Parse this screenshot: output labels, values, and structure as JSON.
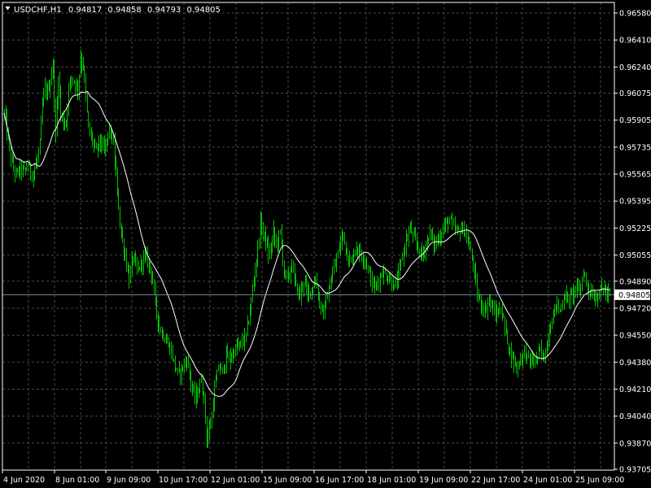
{
  "header": {
    "symbol": "USDCHF,H1",
    "open": "0.94817",
    "high": "0.94858",
    "low": "0.94793",
    "close": "0.94805"
  },
  "colors": {
    "background": "#000000",
    "grid": "#4a4a4a",
    "frame": "#ffffff",
    "bars": "#00c000",
    "moving_average": "#ffffff",
    "bid_line": "#778899"
  },
  "icons": {
    "menu": "triangle-down-icon"
  },
  "chart_data": {
    "type": "bar",
    "title": "USDCHF,H1",
    "grid": true,
    "ylim": [
      0.93705,
      0.9658
    ],
    "y_ticks": [
      "0.96580",
      "0.96410",
      "0.96240",
      "0.96075",
      "0.95905",
      "0.95735",
      "0.95565",
      "0.95395",
      "0.95225",
      "0.95055",
      "0.94890",
      "0.94720",
      "0.94550",
      "0.94380",
      "0.94210",
      "0.94040",
      "0.93870",
      "0.93705"
    ],
    "x_ticks": [
      "4 Jun 2020",
      "8 Jun 01:00",
      "9 Jun 09:00",
      "10 Jun 17:00",
      "12 Jun 01:00",
      "15 Jun 09:00",
      "16 Jun 17:00",
      "18 Jun 01:00",
      "19 Jun 09:00",
      "22 Jun 17:00",
      "24 Jun 01:00",
      "25 Jun 09:00"
    ],
    "bid_price": "0.94805",
    "close_anchors": [
      [
        0,
        0.9595
      ],
      [
        3,
        0.9578
      ],
      [
        6,
        0.9562
      ],
      [
        9,
        0.9556
      ],
      [
        12,
        0.956
      ],
      [
        15,
        0.9558
      ],
      [
        18,
        0.9562
      ],
      [
        21,
        0.9556
      ],
      [
        24,
        0.9562
      ],
      [
        27,
        0.9575
      ],
      [
        29,
        0.96
      ],
      [
        31,
        0.961
      ],
      [
        33,
        0.9608
      ],
      [
        35,
        0.9615
      ],
      [
        37,
        0.9625
      ],
      [
        39,
        0.958
      ],
      [
        41,
        0.962
      ],
      [
        43,
        0.9595
      ],
      [
        45,
        0.9588
      ],
      [
        47,
        0.959
      ],
      [
        49,
        0.961
      ],
      [
        51,
        0.9618
      ],
      [
        53,
        0.9615
      ],
      [
        56,
        0.961
      ],
      [
        58,
        0.963
      ],
      [
        60,
        0.9625
      ],
      [
        62,
        0.9605
      ],
      [
        64,
        0.9585
      ],
      [
        66,
        0.958
      ],
      [
        68,
        0.9575
      ],
      [
        70,
        0.957
      ],
      [
        72,
        0.9578
      ],
      [
        74,
        0.9575
      ],
      [
        76,
        0.957
      ],
      [
        78,
        0.9578
      ],
      [
        80,
        0.9585
      ],
      [
        83,
        0.9575
      ],
      [
        86,
        0.9545
      ],
      [
        89,
        0.9518
      ],
      [
        92,
        0.9505
      ],
      [
        95,
        0.949
      ],
      [
        98,
        0.9505
      ],
      [
        101,
        0.9495
      ],
      [
        104,
        0.95
      ],
      [
        107,
        0.9505
      ],
      [
        110,
        0.95
      ],
      [
        112,
        0.9495
      ],
      [
        115,
        0.9475
      ],
      [
        118,
        0.946
      ],
      [
        121,
        0.9455
      ],
      [
        124,
        0.945
      ],
      [
        127,
        0.9445
      ],
      [
        130,
        0.9435
      ],
      [
        133,
        0.943
      ],
      [
        136,
        0.9435
      ],
      [
        139,
        0.944
      ],
      [
        142,
        0.9425
      ],
      [
        145,
        0.9415
      ],
      [
        148,
        0.942
      ],
      [
        150,
        0.9428
      ],
      [
        152,
        0.9415
      ],
      [
        154,
        0.939
      ],
      [
        156,
        0.9395
      ],
      [
        158,
        0.9405
      ],
      [
        160,
        0.942
      ],
      [
        163,
        0.9435
      ],
      [
        166,
        0.9432
      ],
      [
        169,
        0.9442
      ],
      [
        172,
        0.944
      ],
      [
        175,
        0.9445
      ],
      [
        178,
        0.9448
      ],
      [
        181,
        0.945
      ],
      [
        184,
        0.9455
      ],
      [
        187,
        0.947
      ],
      [
        190,
        0.949
      ],
      [
        193,
        0.951
      ],
      [
        195,
        0.9525
      ],
      [
        197,
        0.952
      ],
      [
        199,
        0.9515
      ],
      [
        201,
        0.9505
      ],
      [
        203,
        0.951
      ],
      [
        205,
        0.952
      ],
      [
        207,
        0.9512
      ],
      [
        210,
        0.952
      ],
      [
        213,
        0.9495
      ],
      [
        216,
        0.949
      ],
      [
        219,
        0.95
      ],
      [
        222,
        0.9485
      ],
      [
        225,
        0.948
      ],
      [
        228,
        0.949
      ],
      [
        231,
        0.948
      ],
      [
        234,
        0.9485
      ],
      [
        237,
        0.949
      ],
      [
        240,
        0.9475
      ],
      [
        243,
        0.947
      ],
      [
        246,
        0.948
      ],
      [
        249,
        0.949
      ],
      [
        252,
        0.95
      ],
      [
        255,
        0.951
      ],
      [
        258,
        0.952
      ],
      [
        261,
        0.9505
      ],
      [
        264,
        0.95
      ],
      [
        267,
        0.951
      ],
      [
        270,
        0.9508
      ],
      [
        273,
        0.9505
      ],
      [
        276,
        0.95
      ],
      [
        279,
        0.949
      ],
      [
        282,
        0.9485
      ],
      [
        285,
        0.949
      ],
      [
        288,
        0.9495
      ],
      [
        291,
        0.9492
      ],
      [
        294,
        0.949
      ],
      [
        297,
        0.9485
      ],
      [
        300,
        0.9492
      ],
      [
        303,
        0.9505
      ],
      [
        306,
        0.9515
      ],
      [
        309,
        0.9522
      ],
      [
        312,
        0.9515
      ],
      [
        315,
        0.951
      ],
      [
        318,
        0.9505
      ],
      [
        321,
        0.9512
      ],
      [
        324,
        0.952
      ],
      [
        327,
        0.9512
      ],
      [
        330,
        0.9515
      ],
      [
        333,
        0.952
      ],
      [
        336,
        0.9525
      ],
      [
        339,
        0.9528
      ],
      [
        342,
        0.9522
      ],
      [
        345,
        0.952
      ],
      [
        348,
        0.9522
      ],
      [
        351,
        0.952
      ],
      [
        354,
        0.951
      ],
      [
        357,
        0.95
      ],
      [
        360,
        0.948
      ],
      [
        363,
        0.9475
      ],
      [
        366,
        0.947
      ],
      [
        369,
        0.9478
      ],
      [
        372,
        0.947
      ],
      [
        375,
        0.9468
      ],
      [
        378,
        0.9472
      ],
      [
        381,
        0.946
      ],
      [
        384,
        0.9448
      ],
      [
        387,
        0.944
      ],
      [
        390,
        0.9435
      ],
      [
        393,
        0.944
      ],
      [
        396,
        0.9445
      ],
      [
        399,
        0.944
      ],
      [
        402,
        0.9438
      ],
      [
        405,
        0.944
      ],
      [
        408,
        0.9445
      ],
      [
        411,
        0.944
      ],
      [
        414,
        0.9455
      ],
      [
        417,
        0.9465
      ],
      [
        420,
        0.9475
      ],
      [
        423,
        0.947
      ],
      [
        426,
        0.948
      ],
      [
        429,
        0.9478
      ],
      [
        432,
        0.948
      ],
      [
        435,
        0.9485
      ],
      [
        438,
        0.9482
      ],
      [
        441,
        0.9495
      ],
      [
        444,
        0.9485
      ],
      [
        447,
        0.9482
      ],
      [
        450,
        0.9478
      ],
      [
        453,
        0.9482
      ],
      [
        456,
        0.9485
      ],
      [
        459,
        0.948
      ],
      [
        461,
        0.9481
      ]
    ]
  }
}
